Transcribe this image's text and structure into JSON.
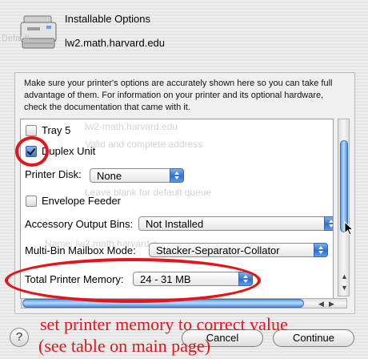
{
  "dialog": {
    "title": "Installable Options",
    "hostname": "lw2.math.harvard.edu",
    "background_ghost": "Default",
    "instructions": "Make sure your printer's options are accurately shown here so you can take full advantage of them.  For information on your printer and its optional hardware, check the documentation that came with it."
  },
  "options": {
    "tray5": {
      "label": "Tray 5",
      "checked": false
    },
    "duplex": {
      "label": "Duplex Unit",
      "checked": true
    },
    "printer_disk": {
      "label": "Printer Disk:",
      "value": "None"
    },
    "envelope_feeder": {
      "label": "Envelope Feeder",
      "checked": false
    },
    "accessory_bins": {
      "label": "Accessory Output Bins:",
      "value": "Not Installed"
    },
    "mailbox_mode": {
      "label": "Multi-Bin Mailbox Mode:",
      "value": "Stacker-Separator-Collator"
    },
    "total_memory": {
      "label": "Total Printer Memory:",
      "value": "24 - 31 MB"
    }
  },
  "ghost_text": {
    "host": "lw2-math.harvard.edu",
    "address": "Valid and complete address",
    "queue": "Leave blank for default queue",
    "name": "Name:  lw2.math.harvard.e"
  },
  "buttons": {
    "help": "?",
    "cancel": "Cancel",
    "continue": "Continue"
  },
  "annotation": {
    "line1": "set printer memory to correct value",
    "line2": "(see table on main page)",
    "color": "#e4141a"
  },
  "colors": {
    "accent": "#2b6fd1",
    "annotation": "#e4141a"
  }
}
